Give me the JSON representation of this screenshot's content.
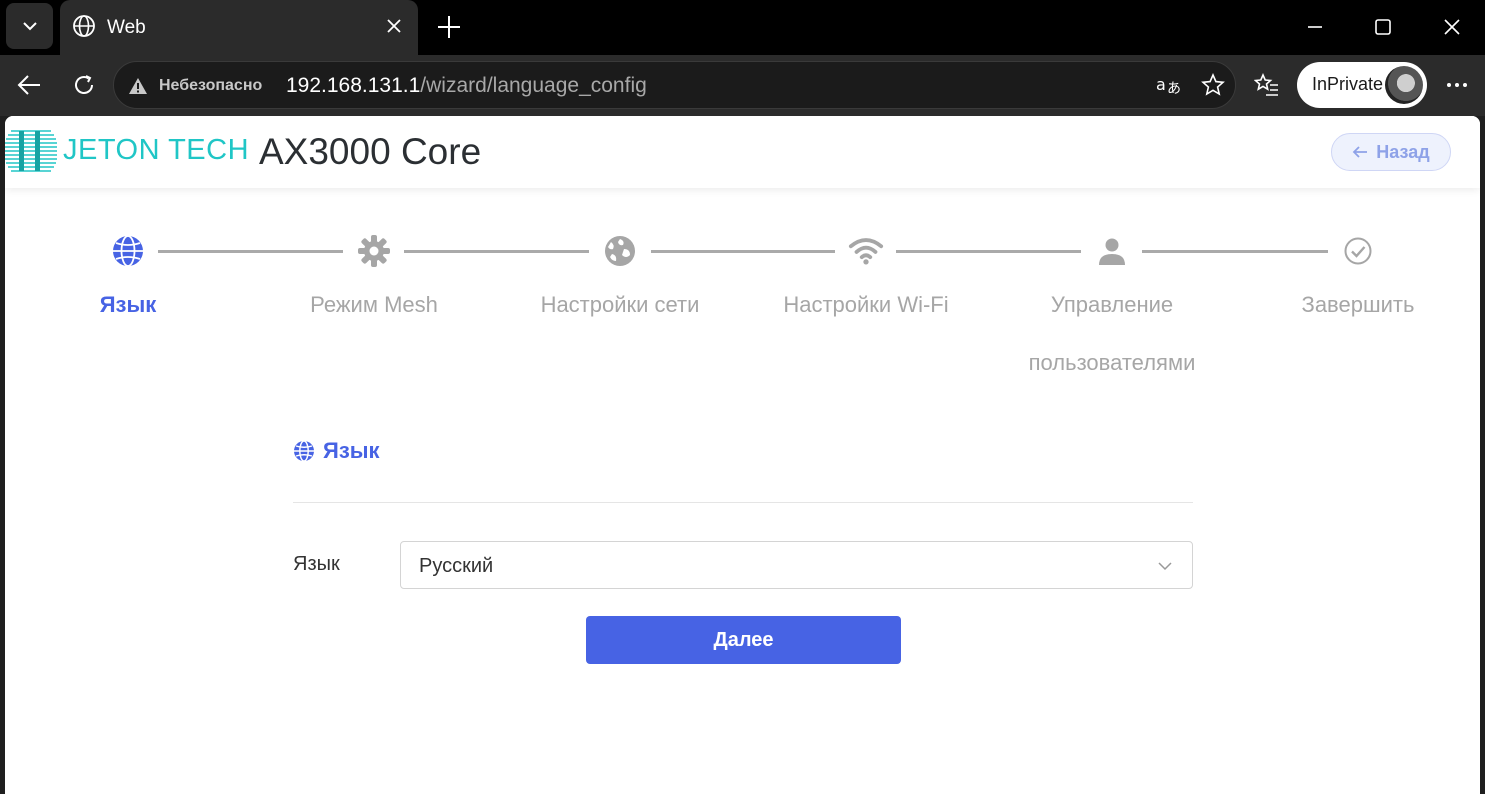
{
  "browser": {
    "tab_title": "Web",
    "security_label": "Небезопасно",
    "url_host": "192.168.131.1",
    "url_path": "/wizard/language_config",
    "inprivate_label": "InPrivate"
  },
  "header": {
    "brand": "JETON TECH",
    "model": "AX3000 Core",
    "back_label": "Назад"
  },
  "wizard": {
    "active_step": 0,
    "steps": [
      {
        "label": "Язык",
        "icon": "globe-icon"
      },
      {
        "label": "Режим Mesh",
        "icon": "gear-icon"
      },
      {
        "label": "Настройки сети",
        "icon": "network-globe-icon"
      },
      {
        "label": "Настройки Wi-Fi",
        "icon": "wifi-icon"
      },
      {
        "label": "Управление пользователями",
        "icon": "user-icon"
      },
      {
        "label": "Завершить",
        "icon": "check-circle-icon"
      }
    ]
  },
  "form": {
    "section_title": "Язык",
    "language_label": "Язык",
    "language_value": "Русский",
    "next_label": "Далее"
  },
  "colors": {
    "accent": "#4763e4",
    "inactive": "#a6a6a6",
    "brand": "#20c6c6"
  }
}
